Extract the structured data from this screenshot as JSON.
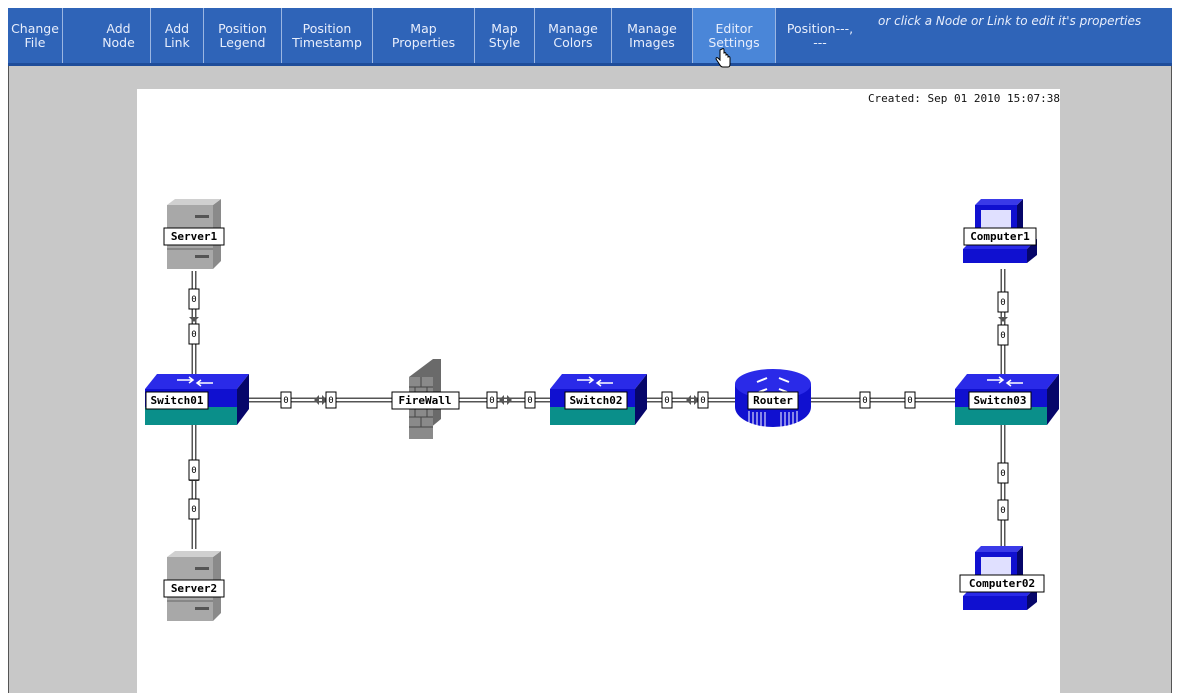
{
  "toolbar": {
    "buttons": [
      {
        "line1": "Change",
        "line2": "File"
      },
      {
        "line1": "Add",
        "line2": "Node"
      },
      {
        "line1": "Add",
        "line2": "Link"
      },
      {
        "line1": "Position",
        "line2": "Legend"
      },
      {
        "line1": "Position",
        "line2": "Timestamp"
      },
      {
        "line1": "Map",
        "line2": "Properties"
      },
      {
        "line1": "Map",
        "line2": "Style"
      },
      {
        "line1": "Manage",
        "line2": "Colors"
      },
      {
        "line1": "Manage",
        "line2": "Images"
      },
      {
        "line1": "Editor",
        "line2": "Settings"
      }
    ],
    "position_label": "Position",
    "position_value": "---, ---",
    "hint": "or click a Node or Link to edit it's properties",
    "active_button": "Editor Settings"
  },
  "map": {
    "created": "Created: Sep 01 2010 15:07:38",
    "nodes": {
      "server1": "Server1",
      "server2": "Server2",
      "switch01": "Switch01",
      "firewall": "FireWall",
      "switch02": "Switch02",
      "router": "Router",
      "switch03": "Switch03",
      "computer1": "Computer1",
      "computer02": "Computer02"
    },
    "link_bandwidth_label": "0"
  },
  "colors": {
    "toolbar_bg": "#2f64b8",
    "switch_blue": "#1010d0",
    "switch_teal": "#0a8f8a",
    "server_gray": "#9a9a9a"
  }
}
